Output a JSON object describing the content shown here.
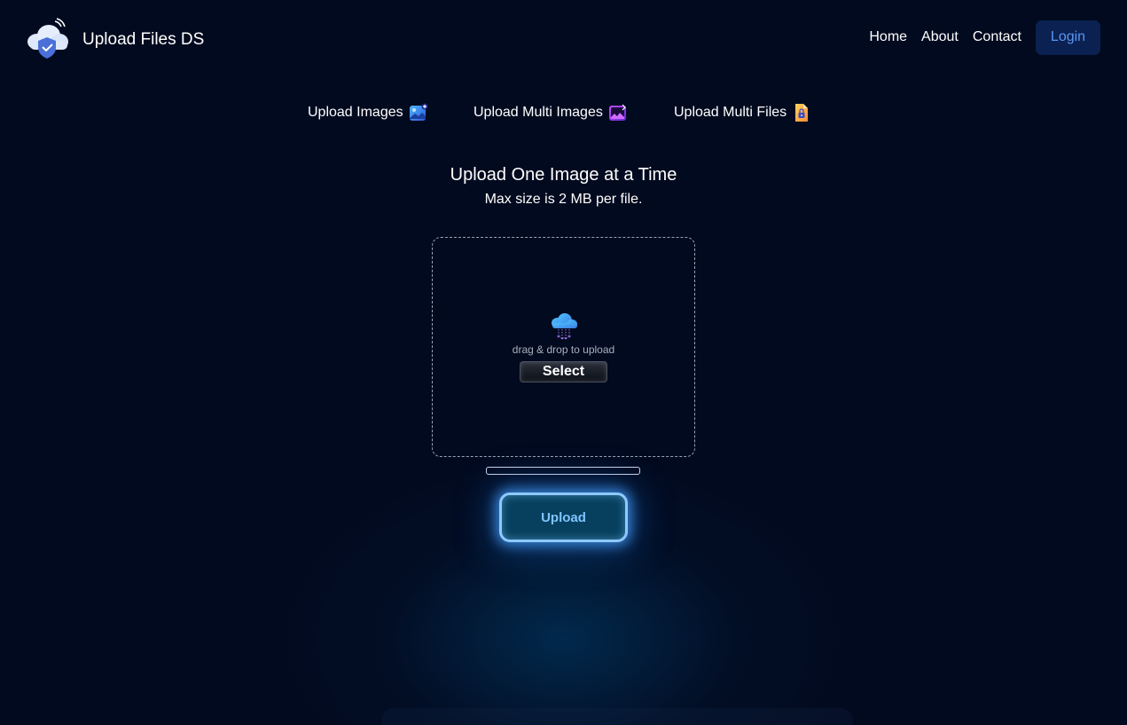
{
  "header": {
    "brand": "Upload Files DS",
    "logo_icon": "cloud-shield-icon",
    "nav": [
      {
        "label": "Home"
      },
      {
        "label": "About"
      },
      {
        "label": "Contact"
      }
    ],
    "login_label": "Login"
  },
  "tabs": [
    {
      "label": "Upload Images",
      "icon": "image-add-icon"
    },
    {
      "label": "Upload Multi Images",
      "icon": "multi-image-icon"
    },
    {
      "label": "Upload Multi Files",
      "icon": "file-lock-icon"
    }
  ],
  "main": {
    "title": "Upload One Image at a Time",
    "subtitle": "Max size is 2 MB per file.",
    "dropzone": {
      "icon": "cloud-upload-icon",
      "hint": "drag & drop to upload",
      "select_label": "Select"
    },
    "progress": 0,
    "upload_label": "Upload"
  },
  "colors": {
    "background": "#020a1f",
    "accent": "#5b96f2",
    "upload_glow": "#8fc8ff"
  }
}
